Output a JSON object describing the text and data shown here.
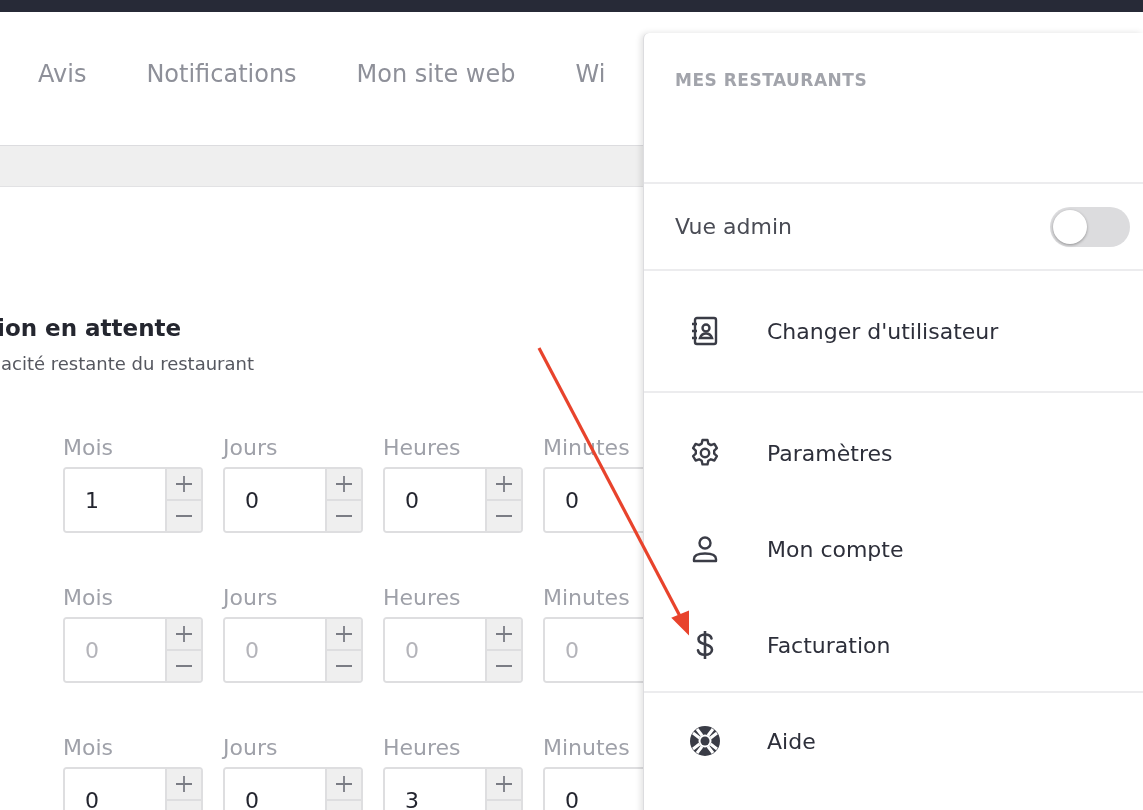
{
  "tabs": [
    {
      "label": "Avis",
      "selected": false
    },
    {
      "label": "Notifications",
      "selected": false
    },
    {
      "label": "Mon site web",
      "selected": false
    },
    {
      "label": "Wi",
      "selected": false
    }
  ],
  "section": {
    "title": "ion en attente",
    "subtitle": "acité restante du restaurant"
  },
  "duration_rows": [
    {
      "fields": [
        {
          "label": "Mois",
          "value": "1"
        },
        {
          "label": "Jours",
          "value": "0"
        },
        {
          "label": "Heures",
          "value": "0"
        },
        {
          "label": "Minutes",
          "value": "0"
        }
      ]
    },
    {
      "fields": [
        {
          "label": "Mois",
          "placeholder": "0"
        },
        {
          "label": "Jours",
          "placeholder": "0"
        },
        {
          "label": "Heures",
          "placeholder": "0"
        },
        {
          "label": "Minutes",
          "placeholder": "0"
        }
      ]
    },
    {
      "fields": [
        {
          "label": "Mois",
          "value": "0"
        },
        {
          "label": "Jours",
          "value": "0"
        },
        {
          "label": "Heures",
          "value": "3"
        },
        {
          "label": "Minutes",
          "value": "0"
        }
      ]
    }
  ],
  "menu": {
    "section_title": "MES RESTAURANTS",
    "admin_toggle": {
      "label": "Vue admin",
      "on": false
    },
    "groups": [
      [
        {
          "kind": "switch-user",
          "label": "Changer d'utilisateur"
        }
      ],
      [
        {
          "kind": "settings",
          "label": "Paramètres"
        },
        {
          "kind": "account",
          "label": "Mon compte"
        },
        {
          "kind": "billing",
          "label": "Facturation"
        }
      ],
      [
        {
          "kind": "help",
          "label": "Aide"
        }
      ]
    ]
  }
}
